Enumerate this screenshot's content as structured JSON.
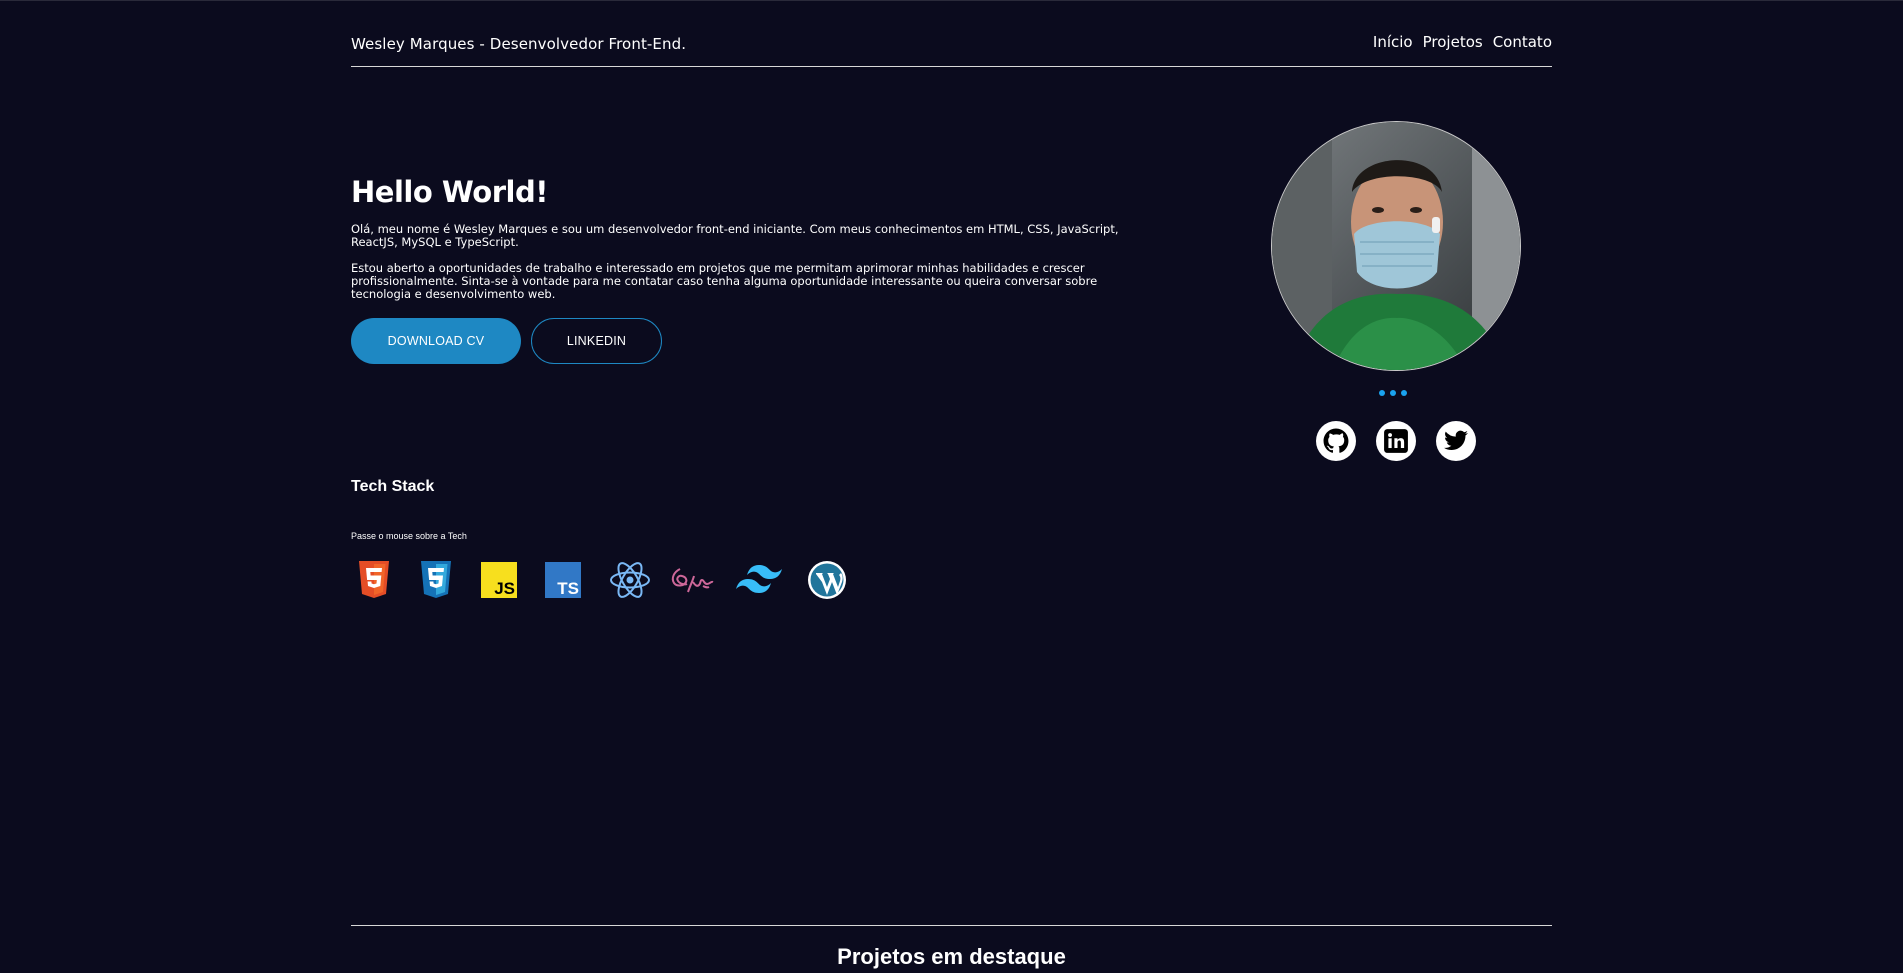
{
  "header": {
    "brand": "Wesley Marques - Desenvolvedor Front-End.",
    "nav": [
      "Início",
      "Projetos",
      "Contato"
    ]
  },
  "hero": {
    "title": "Hello World!",
    "paragraph1": "Olá, meu nome é Wesley Marques e sou um desenvolvedor front-end iniciante. Com meus conhecimentos em HTML, CSS, JavaScript, ReactJS, MySQL e TypeScript.",
    "paragraph2": "Estou aberto a oportunidades de trabalho e interessado em projetos que me permitam aprimorar minhas habilidades e crescer profissionalmente. Sinta-se à vontade para me contatar caso tenha alguma oportunidade interessante ou queira conversar sobre tecnologia e desenvolvimento web.",
    "download_button": "DOWNLOAD CV",
    "linkedin_button": "LINKEDIN"
  },
  "profile": {
    "social": [
      "github-icon",
      "linkedin-icon",
      "twitter-icon"
    ]
  },
  "tech": {
    "title": "Tech Stack",
    "hint": "Passe o mouse sobre a Tech",
    "icons": [
      "html5-icon",
      "css3-icon",
      "javascript-icon",
      "typescript-icon",
      "react-icon",
      "sass-icon",
      "tailwind-icon",
      "wordpress-icon"
    ],
    "js_label": "JS",
    "ts_label": "TS"
  },
  "projects": {
    "title": "Projetos em destaque"
  },
  "colors": {
    "background": "#0b0b1e",
    "accent": "#1e88c3",
    "dots": "#1aa3ef"
  }
}
